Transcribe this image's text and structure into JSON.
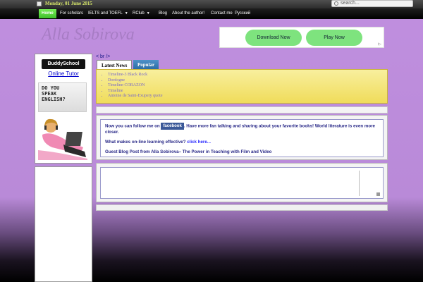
{
  "topbar": {
    "date": "Monday, 01 June 2015",
    "search_placeholder": "search..."
  },
  "nav": {
    "items": [
      {
        "label": "Home"
      },
      {
        "label": "For scholars"
      },
      {
        "label": "IELTS and TOEFL"
      },
      {
        "label": "RClub"
      },
      {
        "label": "Blog"
      },
      {
        "label": "About the author!"
      },
      {
        "label": "Contact me"
      },
      {
        "label": "Русский"
      }
    ]
  },
  "header": {
    "title": "Alla Sobirova"
  },
  "ad": {
    "download": "Download Now",
    "play": "Play Now"
  },
  "sidebar": {
    "buddy": "BuddySchool",
    "tutor": "Online Tutor",
    "speak_line1": "DO YOU",
    "speak_line2": "SPEAK",
    "speak_line3": "ENGLISH?"
  },
  "main": {
    "br_text": "< br />",
    "tabs": [
      "Latest News",
      "Popular"
    ],
    "news": [
      "Timeline-3 Black Rock",
      "Dordogne",
      "Timeline-CORAZON",
      "Timeline",
      "Antoine de Saint-Exupery quote"
    ],
    "follow_pre": "Now you can follow me on",
    "facebook": "facebook",
    "follow_post": ". Have more fan talking and sharing about your favorite books! World literature is even more closer.",
    "learning_q": "What makes on-line learning effective?",
    "click_here": "click here...",
    "guest_post": "Guest Blog Post from Alla Sobirova– The Power in Teaching with Film and Video"
  },
  "colors": {
    "nav_active": "#3fbf2c",
    "background": "#c08fdf",
    "news_bg": "#f0dc5a"
  }
}
